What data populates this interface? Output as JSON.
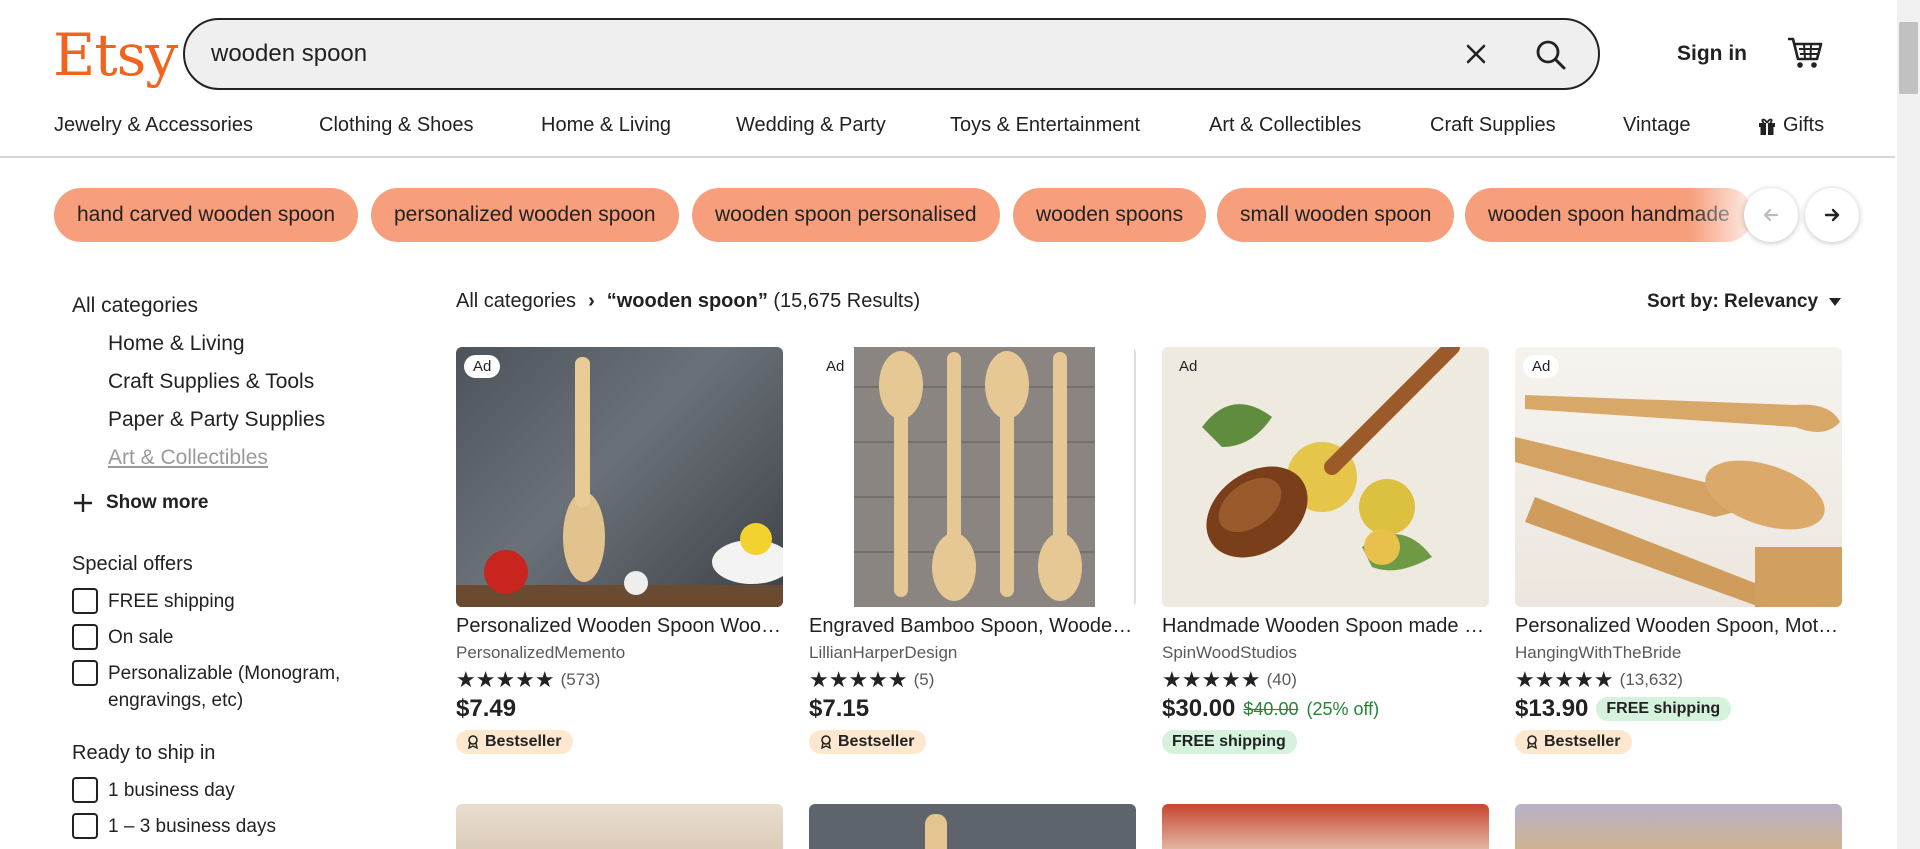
{
  "header": {
    "logo": "Etsy",
    "search": {
      "value": "wooden spoon"
    },
    "sign_in": "Sign in"
  },
  "categories": [
    "Jewelry & Accessories",
    "Clothing & Shoes",
    "Home & Living",
    "Wedding & Party",
    "Toys & Entertainment",
    "Art & Collectibles",
    "Craft Supplies",
    "Vintage",
    "Gifts"
  ],
  "chips": [
    "hand carved wooden spoon",
    "personalized wooden spoon",
    "wooden spoon personalised",
    "wooden spoons",
    "small wooden spoon",
    "wooden spoon handmade"
  ],
  "sidebar": {
    "all_categories": "All categories",
    "subcategories": [
      "Home & Living",
      "Craft Supplies & Tools",
      "Paper & Party Supplies",
      "Art & Collectibles"
    ],
    "show_more": "Show more",
    "special_offers": {
      "heading": "Special offers",
      "options": [
        "FREE shipping",
        "On sale",
        "Personalizable (Monogram, engravings, etc)"
      ]
    },
    "ready_to_ship": {
      "heading": "Ready to ship in",
      "options": [
        "1 business day",
        "1 – 3 business days"
      ]
    }
  },
  "results": {
    "breadcrumb_root": "All categories",
    "query": "“wooden spoon”",
    "count": "(15,675 Results)",
    "sort_label": "Sort by: Relevancy"
  },
  "products": [
    {
      "ad": "Ad",
      "title": "Personalized Wooden Spoon Wood Engraved Spoon Custom Gift",
      "shop": "PersonalizedMemento",
      "stars": "★★★★★",
      "reviews": "(573)",
      "price": "$7.49",
      "badge": "Bestseller"
    },
    {
      "ad": "Ad",
      "title": "Engraved Bamboo Spoon, Wooden Spoon Personalized",
      "shop": "LillianHarperDesign",
      "stars": "★★★★★",
      "reviews": "(5)",
      "price": "$7.15",
      "badge": "Bestseller"
    },
    {
      "ad": "Ad",
      "title": "Handmade Wooden Spoon made from Cherry",
      "shop": "SpinWoodStudios",
      "stars": "★★★★★",
      "reviews": "(40)",
      "price": "$30.00",
      "original_price": "$40.00",
      "discount": "(25% off)",
      "badge": "FREE shipping"
    },
    {
      "ad": "Ad",
      "title": "Personalized Wooden Spoon, Mother's Day Gift",
      "shop": "HangingWithTheBride",
      "stars": "★★★★★",
      "reviews": "(13,632)",
      "price": "$13.90",
      "inline_badge": "FREE shipping",
      "badge": "Bestseller"
    }
  ],
  "colors": {
    "brand": "#f1641e",
    "chip": "#f79f7d",
    "bestseller_bg": "#fde7cf",
    "free_shipping_bg": "#d4f2dc",
    "discount_green": "#238636"
  }
}
